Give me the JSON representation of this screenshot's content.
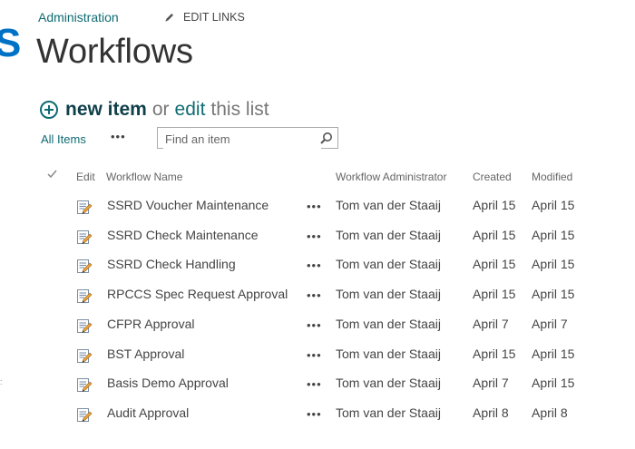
{
  "breadcrumb": {
    "site": "Administration",
    "edit_links": "EDIT LINKS"
  },
  "page": {
    "title": "Workflows"
  },
  "toolbar": {
    "new_item": "new item",
    "or": "or",
    "edit": "edit",
    "this_list": "this list"
  },
  "view": {
    "current": "All Items",
    "more": "•••"
  },
  "search": {
    "placeholder": "Find an item"
  },
  "columns": {
    "edit": "Edit",
    "name": "Workflow Name",
    "admin": "Workflow Administrator",
    "created": "Created",
    "modified": "Modified"
  },
  "row_more": "•••",
  "rows": [
    {
      "name": "SSRD Voucher Maintenance",
      "admin": "Tom van der Staaij",
      "created": "April 15",
      "modified": "April 15"
    },
    {
      "name": "SSRD Check Maintenance",
      "admin": "Tom van der Staaij",
      "created": "April 15",
      "modified": "April 15"
    },
    {
      "name": "SSRD Check Handling",
      "admin": "Tom van der Staaij",
      "created": "April 15",
      "modified": "April 15"
    },
    {
      "name": "RPCCS Spec Request Approval",
      "admin": "Tom van der Staaij",
      "created": "April 15",
      "modified": "April 15"
    },
    {
      "name": "CFPR Approval",
      "admin": "Tom van der Staaij",
      "created": "April 7",
      "modified": "April 7"
    },
    {
      "name": "BST Approval",
      "admin": "Tom van der Staaij",
      "created": "April 15",
      "modified": "April 15"
    },
    {
      "name": "Basis Demo Approval",
      "admin": "Tom van der Staaij",
      "created": "April 7",
      "modified": "April 15"
    },
    {
      "name": "Audit Approval",
      "admin": "Tom van der Staaij",
      "created": "April 8",
      "modified": "April 8"
    }
  ],
  "colors": {
    "accent": "#0f6b73",
    "logo": "#0072c6",
    "text": "#444444"
  },
  "icons": {
    "edit_links": "pencil-icon",
    "new_item": "plus-circle-icon",
    "search": "search-icon",
    "row_edit": "edit-document-icon",
    "select_all": "checkmark-icon"
  }
}
